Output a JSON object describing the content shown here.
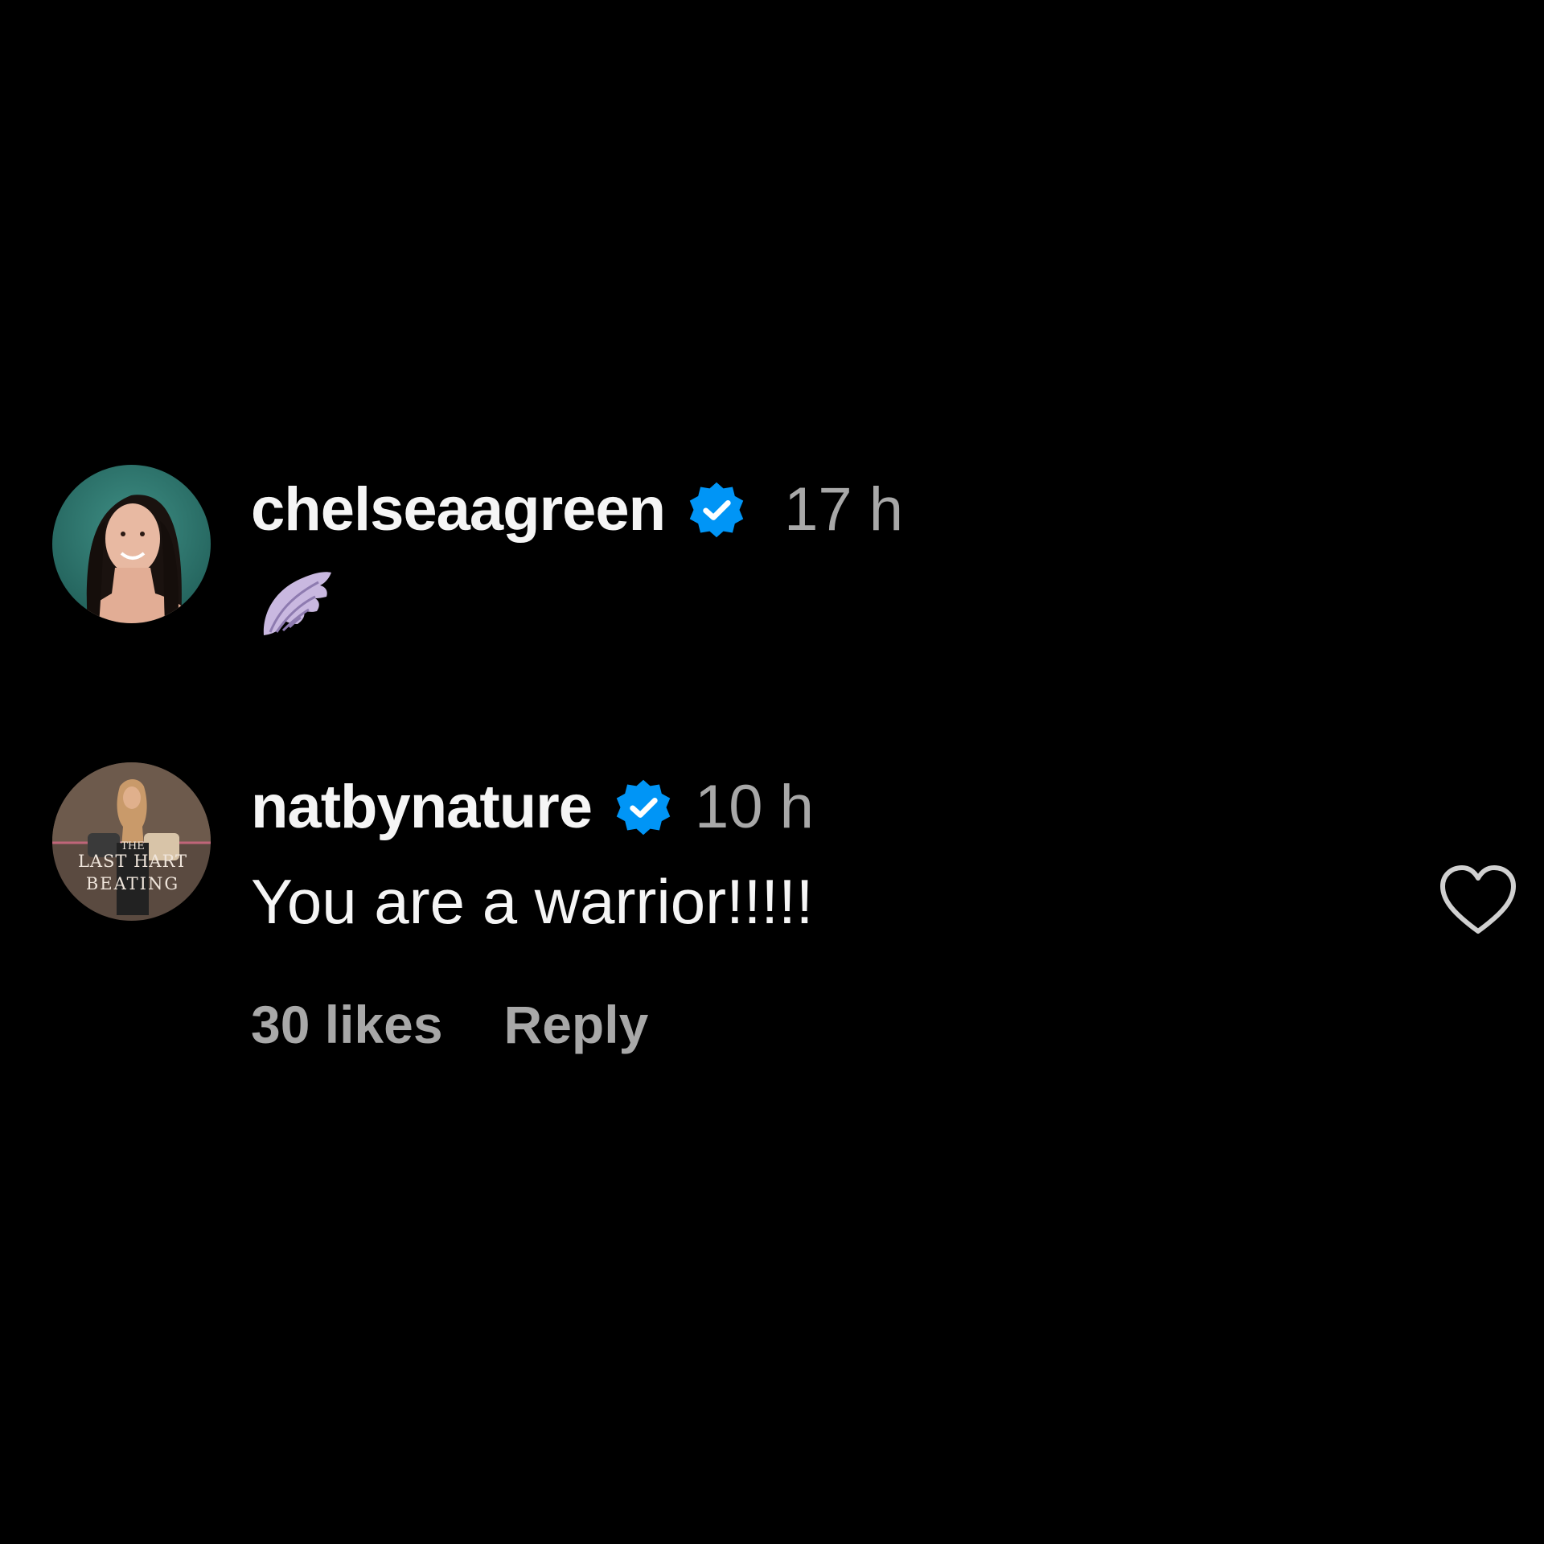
{
  "colors": {
    "background": "#000000",
    "primary_text": "#f5f5f5",
    "secondary_text": "#a8a8a8",
    "verified_badge": "#0095f6"
  },
  "comments": [
    {
      "username": "chelseaagreen",
      "verified": true,
      "time": "17 h",
      "body_emoji": "wing-emoji",
      "avatar": "profile-photo"
    },
    {
      "username": "natbynature",
      "verified": true,
      "time": "10 h",
      "body": "You are a warrior!!!!!",
      "avatar": "profile-photo",
      "avatar_text": {
        "line1": "THE",
        "line2": "LAST HART",
        "line3": "BEATING"
      },
      "likes": "30 likes",
      "reply_label": "Reply",
      "like_icon": "heart-outline-icon"
    }
  ]
}
